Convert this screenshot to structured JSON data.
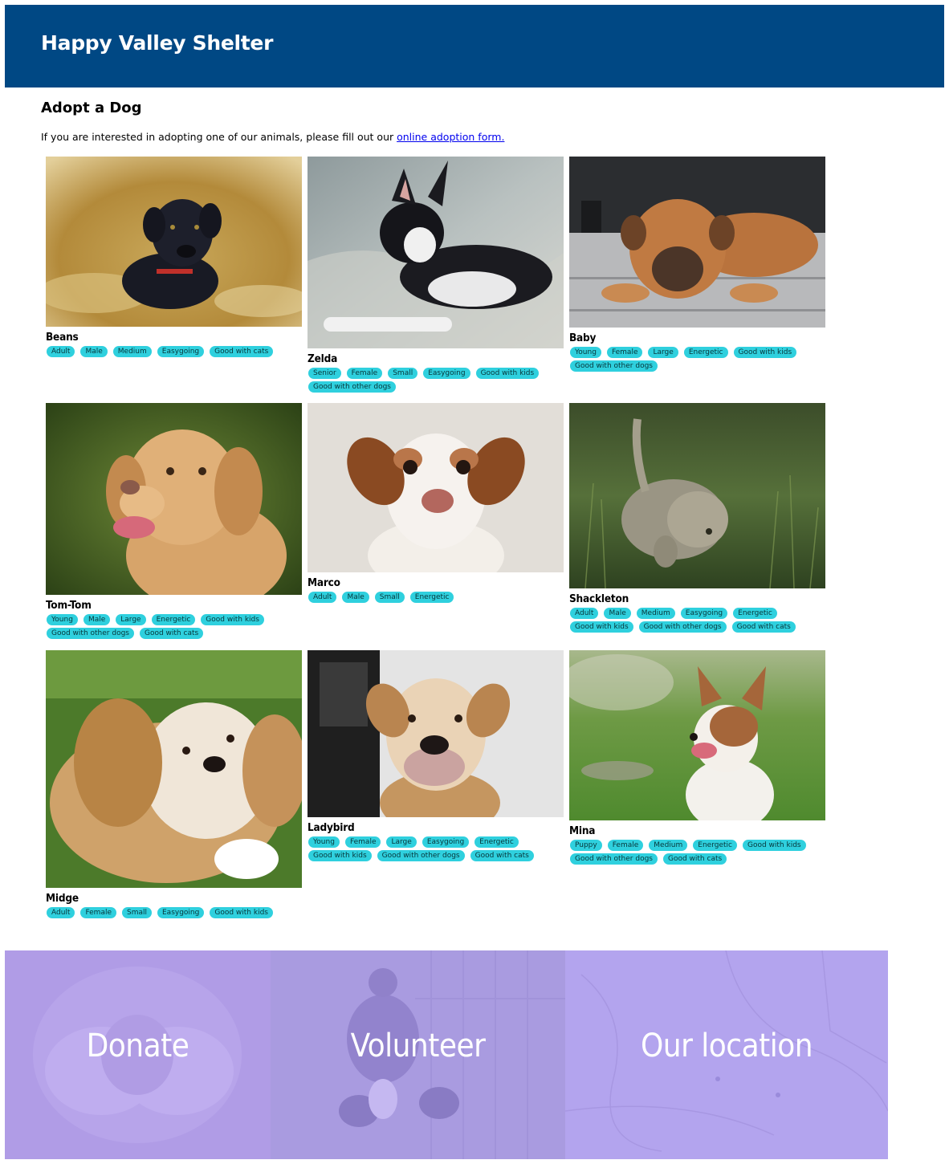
{
  "header": {
    "title": "Happy Valley Shelter"
  },
  "adopt": {
    "heading": "Adopt a Dog",
    "intro_text": "If you are interested in adopting one of our animals, please fill out our ",
    "form_link": "online adoption form."
  },
  "colors": {
    "header_bg": "#004884",
    "tag_bg": "#2fd0de",
    "panel_overlay": "#b6a8f2",
    "link": "#0000ee"
  },
  "dogs": [
    {
      "name": "Beans",
      "tags": [
        "Adult",
        "Male",
        "Medium",
        "Easygoing",
        "Good with cats"
      ]
    },
    {
      "name": "Zelda",
      "tags": [
        "Senior",
        "Female",
        "Small",
        "Easygoing",
        "Good with kids",
        "Good with other dogs"
      ]
    },
    {
      "name": "Baby",
      "tags": [
        "Young",
        "Female",
        "Large",
        "Energetic",
        "Good with kids",
        "Good with other dogs"
      ]
    },
    {
      "name": "Tom-Tom",
      "tags": [
        "Young",
        "Male",
        "Large",
        "Energetic",
        "Good with kids",
        "Good with other dogs",
        "Good with cats"
      ]
    },
    {
      "name": "Marco",
      "tags": [
        "Adult",
        "Male",
        "Small",
        "Energetic"
      ]
    },
    {
      "name": "Shackleton",
      "tags": [
        "Adult",
        "Male",
        "Medium",
        "Easygoing",
        "Energetic",
        "Good with kids",
        "Good with other dogs",
        "Good with cats"
      ]
    },
    {
      "name": "Midge",
      "tags": [
        "Adult",
        "Female",
        "Small",
        "Easygoing",
        "Good with kids"
      ]
    },
    {
      "name": "Ladybird",
      "tags": [
        "Young",
        "Female",
        "Large",
        "Easygoing",
        "Energetic",
        "Good with kids",
        "Good with other dogs",
        "Good with cats"
      ]
    },
    {
      "name": "Mina",
      "tags": [
        "Puppy",
        "Female",
        "Medium",
        "Energetic",
        "Good with kids",
        "Good with other dogs",
        "Good with cats"
      ]
    }
  ],
  "footer": {
    "donate": "Donate",
    "volunteer": "Volunteer",
    "location": "Our location"
  }
}
